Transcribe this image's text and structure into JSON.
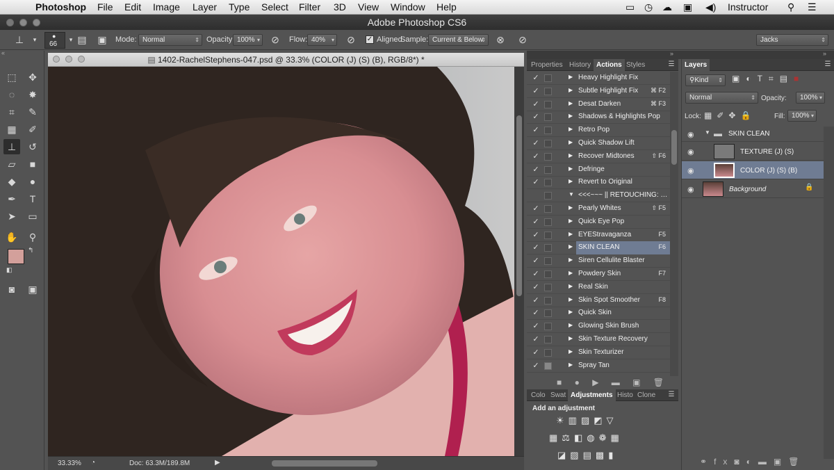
{
  "menubar": {
    "app": "Photoshop",
    "items": [
      "File",
      "Edit",
      "Image",
      "Layer",
      "Type",
      "Select",
      "Filter",
      "3D",
      "View",
      "Window",
      "Help"
    ],
    "user": "Instructor"
  },
  "window": {
    "title": "Adobe Photoshop CS6"
  },
  "options": {
    "brush_size": "66",
    "mode_label": "Mode:",
    "mode_value": "Normal",
    "opacity_label": "Opacity:",
    "opacity_value": "100%",
    "flow_label": "Flow:",
    "flow_value": "40%",
    "aligned_label": "Aligned",
    "sample_label": "Sample:",
    "sample_value": "Current & Below",
    "workspace": "Jacks"
  },
  "document": {
    "title": "1402-RachelStephens-047.psd @ 33.3% (COLOR (J) (S) (B), RGB/8*) *",
    "zoom": "33.33%",
    "doc_info": "Doc: 63.3M/189.8M"
  },
  "actions_panel": {
    "tabs": [
      "Properties",
      "History",
      "Actions",
      "Styles"
    ],
    "active_tab": "Actions",
    "items": [
      {
        "name": "Heavy Highlight Fix",
        "key": ""
      },
      {
        "name": "Subtle Highlight Fix",
        "key": "⌘ F2"
      },
      {
        "name": "Desat Darken",
        "key": "⌘ F3"
      },
      {
        "name": "Shadows & Highlights Pop",
        "key": ""
      },
      {
        "name": "Retro Pop",
        "key": ""
      },
      {
        "name": "Quick Shadow Lift",
        "key": ""
      },
      {
        "name": "Recover Midtones",
        "key": "⇧ F6"
      },
      {
        "name": "Defringe",
        "key": ""
      },
      {
        "name": "Revert to Original",
        "key": ""
      },
      {
        "name": "<<<~~~ || RETOUCHING: [S...",
        "key": ""
      },
      {
        "name": "Pearly Whites",
        "key": "⇧ F5"
      },
      {
        "name": "Quick Eye Pop",
        "key": ""
      },
      {
        "name": "EYEStravaganza",
        "key": "F5"
      },
      {
        "name": "SKIN CLEAN",
        "key": "F6"
      },
      {
        "name": "Siren Cellulite Blaster",
        "key": ""
      },
      {
        "name": "Powdery Skin",
        "key": "F7"
      },
      {
        "name": "Real Skin",
        "key": ""
      },
      {
        "name": "Skin Spot Smoother",
        "key": "F8"
      },
      {
        "name": "Quick Skin",
        "key": ""
      },
      {
        "name": "Glowing Skin Brush",
        "key": ""
      },
      {
        "name": "Skin Texture Recovery",
        "key": ""
      },
      {
        "name": "Skin Texturizer",
        "key": ""
      },
      {
        "name": "Spray Tan",
        "key": ""
      }
    ]
  },
  "adjust_panel": {
    "tabs": [
      "Colo",
      "Swat",
      "Adjustments",
      "Histo",
      "Clone"
    ],
    "active_tab": "Adjustments",
    "heading": "Add an adjustment"
  },
  "layers_panel": {
    "tab": "Layers",
    "kind": "Kind",
    "blend": "Normal",
    "opacity_label": "Opacity:",
    "opacity_value": "100%",
    "lock_label": "Lock:",
    "fill_label": "Fill:",
    "fill_value": "100%",
    "layers": [
      {
        "name": "SKIN CLEAN"
      },
      {
        "name": "TEXTURE (J) (S)"
      },
      {
        "name": "COLOR (J) (S) (B)"
      },
      {
        "name": "Background"
      }
    ]
  },
  "colors": {
    "foreground": "#d3a09b",
    "background": "#ffffff",
    "selection": "#6f7c93"
  }
}
